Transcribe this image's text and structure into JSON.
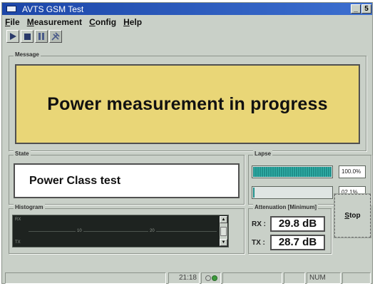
{
  "window": {
    "title": "AVTS  GSM Test"
  },
  "titlebar_buttons": {
    "minimize": "_",
    "restore": "5"
  },
  "menu": [
    {
      "label": "File",
      "u": "F",
      "rest": "ile"
    },
    {
      "label": "Measurement",
      "u": "M",
      "rest": "easurement"
    },
    {
      "label": "Config",
      "u": "C",
      "rest": "onfig"
    },
    {
      "label": "Help",
      "u": "H",
      "rest": "elp"
    }
  ],
  "toolbar": {
    "icons": [
      "play-icon",
      "stop-square-icon",
      "pause-icon",
      "tools-icon"
    ]
  },
  "message": {
    "group_label": "Message",
    "text": "Power measurement in progress"
  },
  "state": {
    "group_label": "State",
    "text": "Power Class test"
  },
  "lapse": {
    "group_label": "Lapse",
    "bars": [
      {
        "progress": 1.0,
        "value": "100.0%"
      },
      {
        "progress": 0.021,
        "value": "02.1%"
      }
    ]
  },
  "histogram": {
    "group_label": "Histogram",
    "label_top": "RX",
    "label_bottom": "TX",
    "mark_left": "10",
    "mark_right": "20"
  },
  "attenuation": {
    "group_label": "Attenuation [Minimum]",
    "rx_label": "RX :",
    "rx_value": "29.8 dB",
    "tx_label": "TX :",
    "tx_value": "28.7 dB"
  },
  "stop_button": {
    "underlined": "S",
    "rest": "top"
  },
  "statusbar": {
    "time": "21:18",
    "num": "NUM"
  },
  "colors": {
    "window_bg": "#c9d0c8",
    "message_bg": "#e9d677",
    "progress": "#2aa39c",
    "titlebar": "#1c46a8"
  }
}
